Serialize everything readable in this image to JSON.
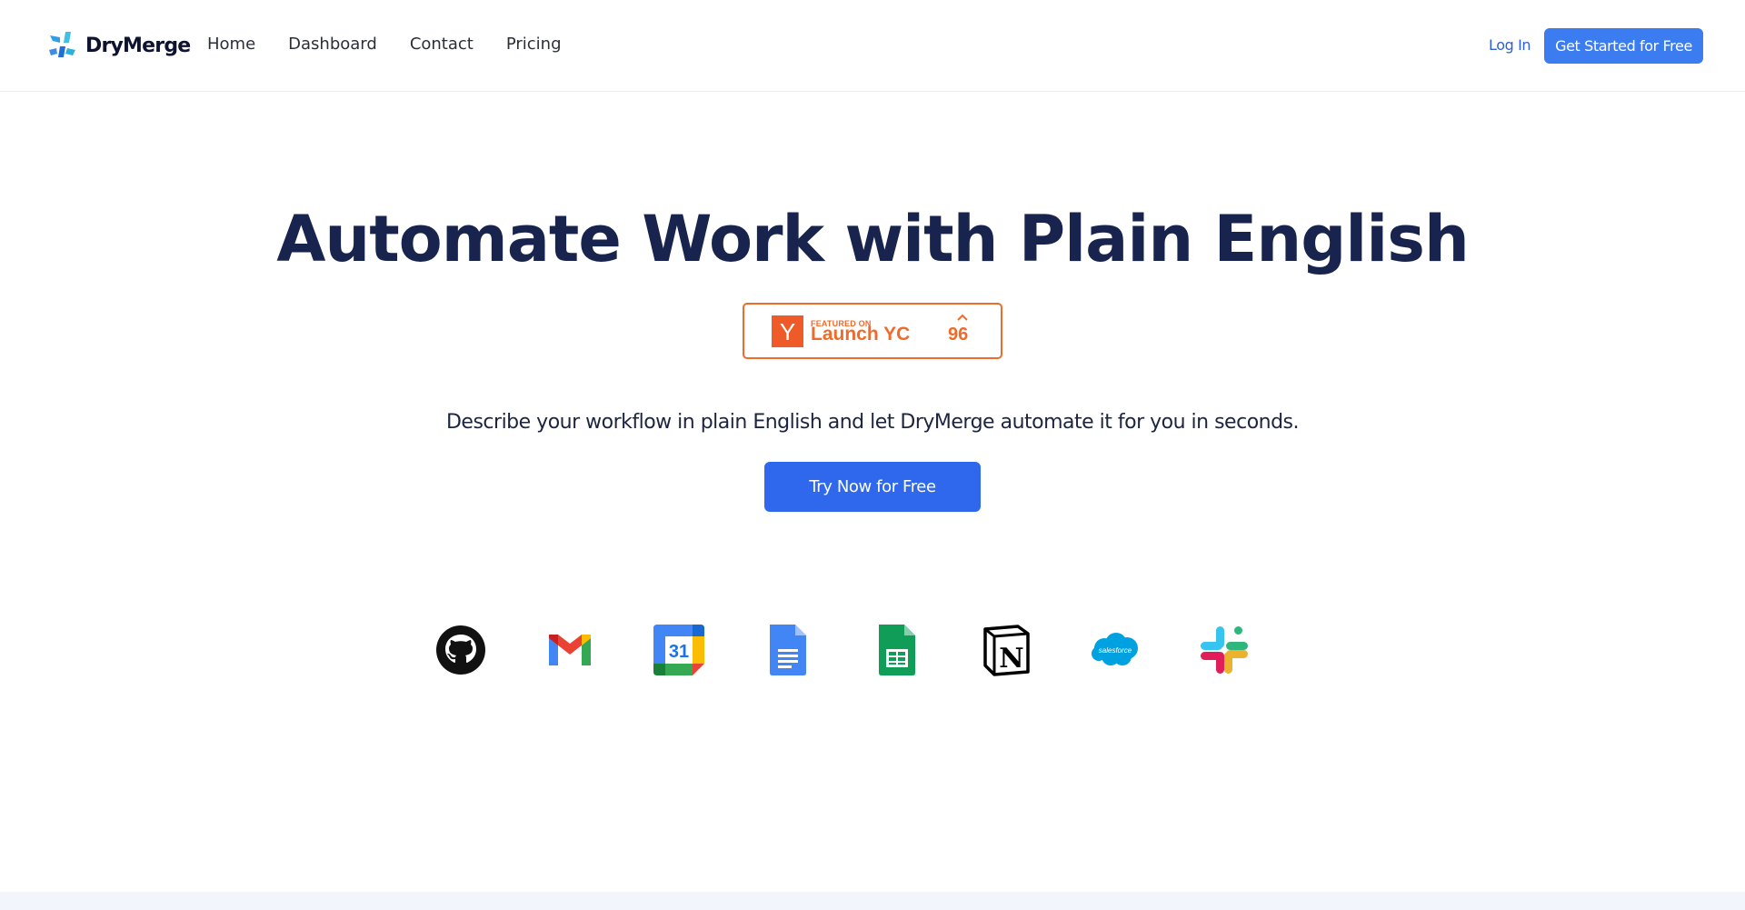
{
  "brand": {
    "name": "DryMerge"
  },
  "nav": {
    "items": [
      {
        "label": "Home"
      },
      {
        "label": "Dashboard"
      },
      {
        "label": "Contact"
      },
      {
        "label": "Pricing"
      }
    ]
  },
  "header_actions": {
    "login_label": "Log In",
    "get_started_label": "Get Started for Free"
  },
  "hero": {
    "title": "Automate Work with Plain English",
    "subtitle": "Describe your workflow in plain English and let DryMerge automate it for you in seconds.",
    "cta_label": "Try Now for Free"
  },
  "yc_badge": {
    "logo_letter": "Y",
    "featured_label": "FEATURED ON",
    "name": "Launch YC",
    "upvotes": "96",
    "color": "#ef6b2b"
  },
  "integrations": [
    {
      "icon": "github-icon"
    },
    {
      "icon": "gmail-icon"
    },
    {
      "icon": "google-calendar-icon",
      "label": "31"
    },
    {
      "icon": "google-docs-icon"
    },
    {
      "icon": "google-sheets-icon"
    },
    {
      "icon": "notion-icon",
      "label": "N"
    },
    {
      "icon": "salesforce-icon",
      "label": "salesforce"
    },
    {
      "icon": "slack-icon"
    }
  ],
  "colors": {
    "primary": "#2f68ec",
    "primary_light": "#3b7cf0",
    "title": "#18244d"
  }
}
